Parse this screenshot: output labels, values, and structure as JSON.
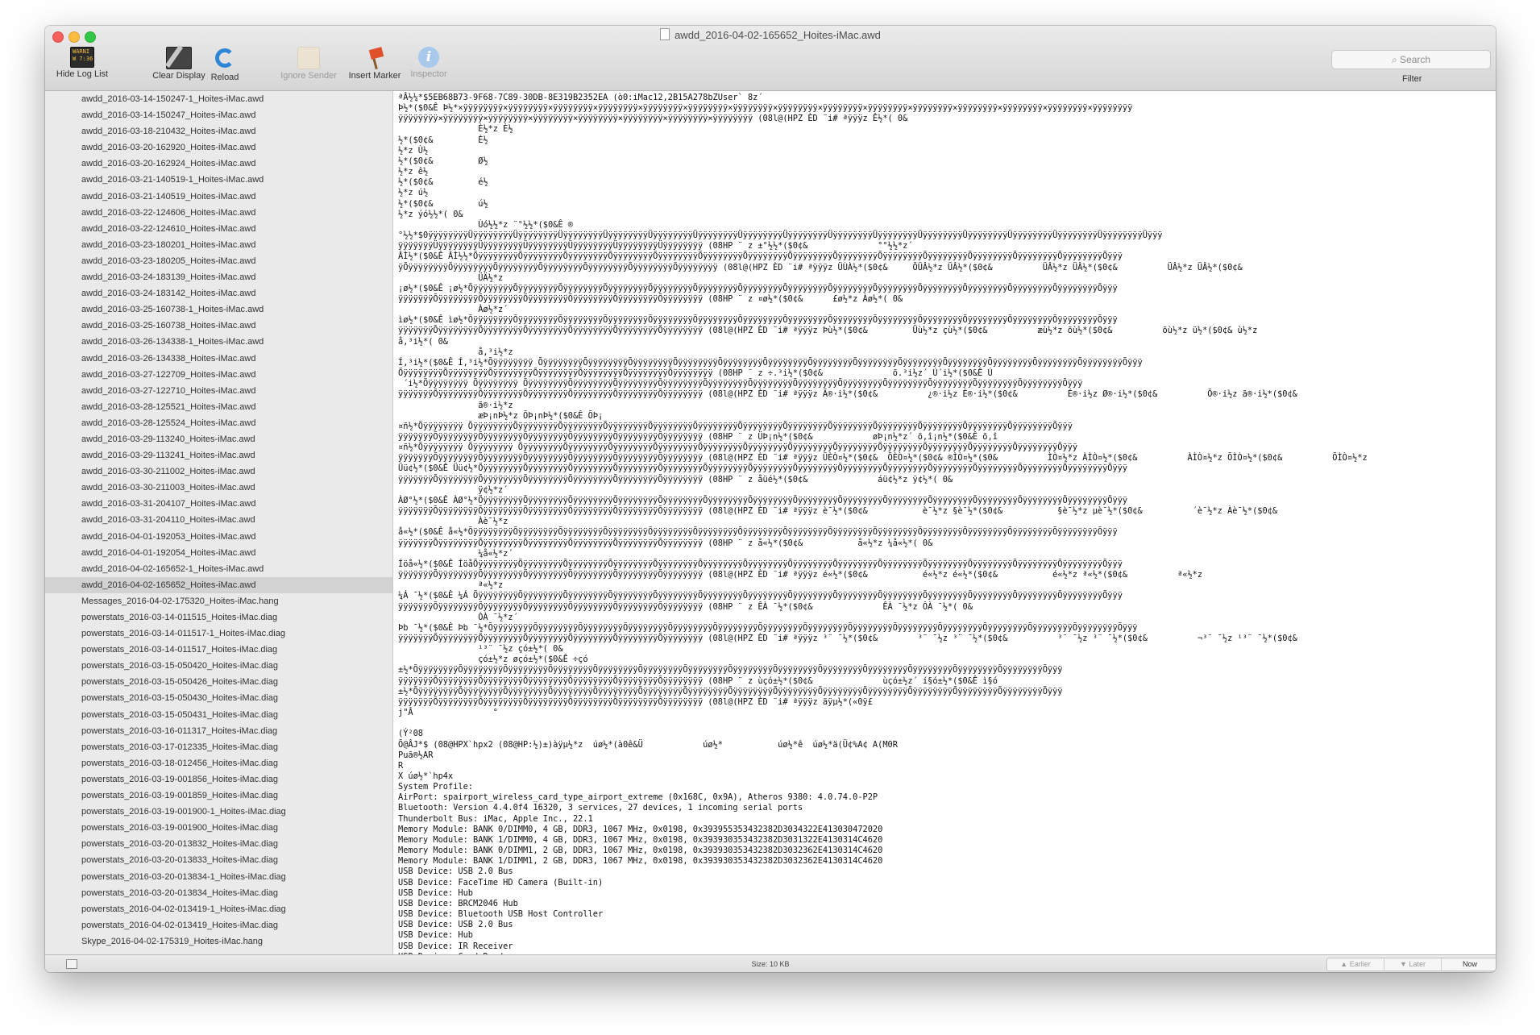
{
  "window": {
    "title": "awdd_2016-04-02-165652_Hoites-iMac.awd"
  },
  "toolbar": {
    "hide_log_list": "Hide Log List",
    "clear_display": "Clear Display",
    "reload": "Reload",
    "ignore_sender": "Ignore Sender",
    "insert_marker": "Insert Marker",
    "inspector": "Inspector",
    "search_placeholder": "Search",
    "filter": "Filter",
    "console_icon_text": "WARNI\nW 7:36"
  },
  "sidebar": {
    "items": [
      "awdd_2016-03-14-150247-1_Hoites-iMac.awd",
      "awdd_2016-03-14-150247_Hoites-iMac.awd",
      "awdd_2016-03-18-210432_Hoites-iMac.awd",
      "awdd_2016-03-20-162920_Hoites-iMac.awd",
      "awdd_2016-03-20-162924_Hoites-iMac.awd",
      "awdd_2016-03-21-140519-1_Hoites-iMac.awd",
      "awdd_2016-03-21-140519_Hoites-iMac.awd",
      "awdd_2016-03-22-124606_Hoites-iMac.awd",
      "awdd_2016-03-22-124610_Hoites-iMac.awd",
      "awdd_2016-03-23-180201_Hoites-iMac.awd",
      "awdd_2016-03-23-180205_Hoites-iMac.awd",
      "awdd_2016-03-24-183139_Hoites-iMac.awd",
      "awdd_2016-03-24-183142_Hoites-iMac.awd",
      "awdd_2016-03-25-160738-1_Hoites-iMac.awd",
      "awdd_2016-03-25-160738_Hoites-iMac.awd",
      "awdd_2016-03-26-134338-1_Hoites-iMac.awd",
      "awdd_2016-03-26-134338_Hoites-iMac.awd",
      "awdd_2016-03-27-122709_Hoites-iMac.awd",
      "awdd_2016-03-27-122710_Hoites-iMac.awd",
      "awdd_2016-03-28-125521_Hoites-iMac.awd",
      "awdd_2016-03-28-125524_Hoites-iMac.awd",
      "awdd_2016-03-29-113240_Hoites-iMac.awd",
      "awdd_2016-03-29-113241_Hoites-iMac.awd",
      "awdd_2016-03-30-211002_Hoites-iMac.awd",
      "awdd_2016-03-30-211003_Hoites-iMac.awd",
      "awdd_2016-03-31-204107_Hoites-iMac.awd",
      "awdd_2016-03-31-204110_Hoites-iMac.awd",
      "awdd_2016-04-01-192053_Hoites-iMac.awd",
      "awdd_2016-04-01-192054_Hoites-iMac.awd",
      "awdd_2016-04-02-165652-1_Hoites-iMac.awd",
      "awdd_2016-04-02-165652_Hoites-iMac.awd",
      "Messages_2016-04-02-175320_Hoites-iMac.hang",
      "powerstats_2016-03-14-011515_Hoites-iMac.diag",
      "powerstats_2016-03-14-011517-1_Hoites-iMac.diag",
      "powerstats_2016-03-14-011517_Hoites-iMac.diag",
      "powerstats_2016-03-15-050420_Hoites-iMac.diag",
      "powerstats_2016-03-15-050426_Hoites-iMac.diag",
      "powerstats_2016-03-15-050430_Hoites-iMac.diag",
      "powerstats_2016-03-15-050431_Hoites-iMac.diag",
      "powerstats_2016-03-16-011317_Hoites-iMac.diag",
      "powerstats_2016-03-17-012335_Hoites-iMac.diag",
      "powerstats_2016-03-18-012456_Hoites-iMac.diag",
      "powerstats_2016-03-19-001856_Hoites-iMac.diag",
      "powerstats_2016-03-19-001859_Hoites-iMac.diag",
      "powerstats_2016-03-19-001900-1_Hoites-iMac.diag",
      "powerstats_2016-03-19-001900_Hoites-iMac.diag",
      "powerstats_2016-03-20-013832_Hoites-iMac.diag",
      "powerstats_2016-03-20-013833_Hoites-iMac.diag",
      "powerstats_2016-03-20-013834-1_Hoites-iMac.diag",
      "powerstats_2016-03-20-013834_Hoites-iMac.diag",
      "powerstats_2016-04-02-013419-1_Hoites-iMac.diag",
      "powerstats_2016-04-02-013419_Hoites-iMac.diag",
      "Skype_2016-04-02-175319_Hoites-iMac.hang"
    ],
    "selected_index": 30
  },
  "log": {
    "text": "ªÂ½¼*$5EB68B73-9F68-7C89-30DB-8E319B2352EA (ò0:iMac12,2B15A278bZUser` 8z´\nÞ½*($0&Ê Þ½*×ÿÿÿÿÿÿÿÿ×ÿÿÿÿÿÿÿÿ×ÿÿÿÿÿÿÿÿ×ÿÿÿÿÿÿÿÿ×ÿÿÿÿÿÿÿÿ×ÿÿÿÿÿÿÿÿ×ÿÿÿÿÿÿÿÿ×ÿÿÿÿÿÿÿÿ×ÿÿÿÿÿÿÿÿ×ÿÿÿÿÿÿÿÿ×ÿÿÿÿÿÿÿÿ×ÿÿÿÿÿÿÿÿ×ÿÿÿÿÿÿÿÿ×ÿÿÿÿÿÿÿÿ×ÿÿÿÿÿÿÿÿ\nÿÿÿÿÿÿÿÿ×ÿÿÿÿÿÿÿÿ×ÿÿÿÿÿÿÿÿ×ÿÿÿÿÿÿÿÿ×ÿÿÿÿÿÿÿÿ×ÿÿÿÿÿÿÿÿ×ÿÿÿÿÿÿÿÿ×ÿÿÿÿÿÿÿÿ (08l@(HPZ ÈD ¨i# ªÿÿÿz Ê½*( 0&\n                È½*z È½\n½*($0¢&         È½\n½*z Ù½\n½*($0¢&         Ø½\n½*z ê½\n½*($0¢&         é½\n½*z ú½\n½*($0¢&         ú½\n½*z ýó½½*( 0&\n                Ùó½½*z ¨°½½*($0&Ê ®\n°½½*$0ÿÿÿÿÿÿÿÿÜÿÿÿÿÿÿÿÿÜÿÿÿÿÿÿÿÿÜÿÿÿÿÿÿÿÿÜÿÿÿÿÿÿÿÿÜÿÿÿÿÿÿÿÿÜÿÿÿÿÿÿÿÿÜÿÿÿÿÿÿÿÿÜÿÿÿÿÿÿÿÿÜÿÿÿÿÿÿÿÿÜÿÿÿÿÿÿÿÿÜÿÿÿÿÿÿÿÿÜÿÿÿÿÿÿÿÿÜÿÿÿÿÿÿÿÿÜÿÿÿÿÿÿÿÿÜÿÿÿÿÿÿÿÿÜÿÿÿ\nÿÿÿÿÿÿÿÜÿÿÿÿÿÿÿÿÜÿÿÿÿÿÿÿÿÜÿÿÿÿÿÿÿÿÜÿÿÿÿÿÿÿÿÜÿÿÿÿÿÿÿÿÜÿÿÿÿÿÿÿÿ (08HP ¨ z ±°½½*($0¢&              °°½½*z´\nÂÌ½*($0&Ê ÂÌ½½*ÕÿÿÿÿÿÿÿÿÕÿÿÿÿÿÿÿÿÕÿÿÿÿÿÿÿÿÕÿÿÿÿÿÿÿÿÕÿÿÿÿÿÿÿÿÕÿÿÿÿÿÿÿÿÕÿÿÿÿÿÿÿÿÕÿÿÿÿÿÿÿÿÕÿÿÿÿÿÿÿÿÕÿÿÿÿÿÿÿÿÕÿÿÿÿÿÿÿÿÕÿÿÿÿÿÿÿÿÕÿÿÿÿÿÿÿÿÕÿÿÿÿÿÿÿÿÕÿÿÿ\nÿÕÿÿÿÿÿÿÿÿÕÿÿÿÿÿÿÿÿÕÿÿÿÿÿÿÿÿÕÿÿÿÿÿÿÿÿÕÿÿÿÿÿÿÿÿÕÿÿÿÿÿÿÿÿÕÿÿÿÿÿÿÿÿ (08l@(HPZ ÈD ¨i# ªÿÿÿz ÜÙÀ½*($0¢&     ÕÜÂ½*z ÜÂ½*($0¢&          ÜÂ½*z ÜÂ½*($0¢&          ÜÂ½*z ÜÂ½*($0¢&\n                ÜÄ½*z\n¡ø½*($0&Ê ¡ø½*ÕÿÿÿÿÿÿÿÿÕÿÿÿÿÿÿÿÿÕÿÿÿÿÿÿÿÿÕÿÿÿÿÿÿÿÿÕÿÿÿÿÿÿÿÿÕÿÿÿÿÿÿÿÿÕÿÿÿÿÿÿÿÿÕÿÿÿÿÿÿÿÿÕÿÿÿÿÿÿÿÿÕÿÿÿÿÿÿÿÿÕÿÿÿÿÿÿÿÿÕÿÿÿÿÿÿÿÿÕÿÿÿÿÿÿÿÿÕÿÿÿÿÿÿÿÿÕÿÿÿ\nÿÿÿÿÿÿÿÕÿÿÿÿÿÿÿÿÕÿÿÿÿÿÿÿÿÕÿÿÿÿÿÿÿÿÕÿÿÿÿÿÿÿÿÕÿÿÿÿÿÿÿÿÕÿÿÿÿÿÿÿÿ (08HP ¨ z ¤ø½*($0¢&      £ø½*z Àø½*( 0&\n                Àø½*z´\nìø½*($0&Ê ìø½*ÕÿÿÿÿÿÿÿÿÕÿÿÿÿÿÿÿÿÕÿÿÿÿÿÿÿÿÕÿÿÿÿÿÿÿÿÕÿÿÿÿÿÿÿÿÕÿÿÿÿÿÿÿÿÕÿÿÿÿÿÿÿÿÕÿÿÿÿÿÿÿÿÕÿÿÿÿÿÿÿÿÕÿÿÿÿÿÿÿÿÕÿÿÿÿÿÿÿÿÕÿÿÿÿÿÿÿÿÕÿÿÿÿÿÿÿÿÕÿÿÿÿÿÿÿÿÕÿÿÿ\nÿÿÿÿÿÿÿÕÿÿÿÿÿÿÿÿÕÿÿÿÿÿÿÿÿÕÿÿÿÿÿÿÿÿÕÿÿÿÿÿÿÿÿÕÿÿÿÿÿÿÿÿÕÿÿÿÿÿÿÿÿ (08l@(HPZ ÈD ¨i# ªÿÿÿz Þù½*($0¢&         Üù½*z çù½*($0¢&          æù½*z õù½*($0¢&          õù½*z ü½*($0¢& ù½*z\nå,³i½*( 0&\n                å,³i½*z\nÍ,³i½*($0&Ê Í,³i½*Õÿÿÿÿÿÿÿÿ ÕÿÿÿÿÿÿÿÿÕÿÿÿÿÿÿÿÿÕÿÿÿÿÿÿÿÿÕÿÿÿÿÿÿÿÿÕÿÿÿÿÿÿÿÿÕÿÿÿÿÿÿÿÿÕÿÿÿÿÿÿÿÿÕÿÿÿÿÿÿÿÿÕÿÿÿÿÿÿÿÿÕÿÿÿÿÿÿÿÿÕÿÿÿÿÿÿÿÿÕÿÿÿÿÿÿÿÿÕÿÿÿÿÿÿÿÿÕÿÿÿ\nÕÿÿÿÿÿÿÿÿÕÿÿÿÿÿÿÿÿÕÿÿÿÿÿÿÿÿÕÿÿÿÿÿÿÿÿÕÿÿÿÿÿÿÿÿÕÿÿÿÿÿÿÿÿÕÿÿÿÿÿÿÿÿ (08HP ¨ z ÷.³i½*($0¢&              õ.³i½z´ Ú´i½*($0&Ê Ú\n ´i½*Õÿÿÿÿÿÿÿÿ Õÿÿÿÿÿÿÿÿ ÕÿÿÿÿÿÿÿÿÕÿÿÿÿÿÿÿÿÕÿÿÿÿÿÿÿÿÕÿÿÿÿÿÿÿÿÕÿÿÿÿÿÿÿÿÕÿÿÿÿÿÿÿÿÕÿÿÿÿÿÿÿÿÕÿÿÿÿÿÿÿÿÕÿÿÿÿÿÿÿÿÕÿÿÿÿÿÿÿÿÕÿÿÿÿÿÿÿÿÕÿÿÿÿÿÿÿÿÕÿÿÿ\nÿÿÿÿÿÿÿÕÿÿÿÿÿÿÿÿÕÿÿÿÿÿÿÿÿÕÿÿÿÿÿÿÿÿÕÿÿÿÿÿÿÿÿÕÿÿÿÿÿÿÿÿÕÿÿÿÿÿÿÿÿ (08l@(HPZ ÈD ¨i# ªÿÿÿz Ã®·i½*($0¢&          ¿®·i½z È®·i½*($0¢&          É®·i½z Ø®·i½*($0¢&          Ö®·i½z ã®·i½*($0¢&\n                ã®·i½*z\n                æÞ¡nÞ½*z ÕÞ¡nÞ½*($0&Ê ÕÞ¡\n¤ñ½*Õÿÿÿÿÿÿÿÿ ÕÿÿÿÿÿÿÿÿÕÿÿÿÿÿÿÿÿÕÿÿÿÿÿÿÿÿÕÿÿÿÿÿÿÿÿÕÿÿÿÿÿÿÿÿÕÿÿÿÿÿÿÿÿÕÿÿÿÿÿÿÿÿÕÿÿÿÿÿÿÿÿÕÿÿÿÿÿÿÿÿÕÿÿÿÿÿÿÿÿÕÿÿÿÿÿÿÿÿÕÿÿÿÿÿÿÿÿÕÿÿÿÿÿÿÿÿÕÿÿÿ\nÿÿÿÿÿÿÿÕÿÿÿÿÿÿÿÿÕÿÿÿÿÿÿÿÿÕÿÿÿÿÿÿÿÿÕÿÿÿÿÿÿÿÿÕÿÿÿÿÿÿÿÿÕÿÿÿÿÿÿÿÿ (08HP ¨ z ÜÞ¡n½*($0¢&            øÞ¡n½*z´ õ,î¡n½*($0&Ê õ,î\n¤ñ½*Õÿÿÿÿÿÿÿÿ Õÿÿÿÿÿÿÿÿ ÕÿÿÿÿÿÿÿÿÕÿÿÿÿÿÿÿÿÕÿÿÿÿÿÿÿÿÕÿÿÿÿÿÿÿÿÕÿÿÿÿÿÿÿÿÕÿÿÿÿÿÿÿÿÕÿÿÿÿÿÿÿÿÕÿÿÿÿÿÿÿÿÕÿÿÿÿÿÿÿÿÕÿÿÿÿÿÿÿÿÕÿÿÿÿÿÿÿÿÕÿÿÿÿÿÿÿÿÕÿÿÿ\nÿÿÿÿÿÿÿÕÿÿÿÿÿÿÿÿÕÿÿÿÿÿÿÿÿÕÿÿÿÿÿÿÿÿÕÿÿÿÿÿÿÿÿÕÿÿÿÿÿÿÿÿÕÿÿÿÿÿÿÿÿ (08l@(HPZ ÈD ¨i# ªÿÿÿz ÜÈÒ¤½*($0¢&  ÕÈÒ¤½*($0¢& ®ÌÒ¤½*($0&          ÌÒ¤½*z ÀÌÒ¤½*($0¢&          ÀÌÒ¤½*z ÕÌÒ¤½*($0¢&          ÕÌÒ¤½*z\nÜü¢½*($0&Ê Üü¢½*ÕÿÿÿÿÿÿÿÿÕÿÿÿÿÿÿÿÿÕÿÿÿÿÿÿÿÿÕÿÿÿÿÿÿÿÿÕÿÿÿÿÿÿÿÿÕÿÿÿÿÿÿÿÿÕÿÿÿÿÿÿÿÿÕÿÿÿÿÿÿÿÿÕÿÿÿÿÿÿÿÿÕÿÿÿÿÿÿÿÿÕÿÿÿÿÿÿÿÿÕÿÿÿÿÿÿÿÿÕÿÿÿÿÿÿÿÿÕÿÿÿÿÿÿÿÿÕÿÿÿ\nÿÿÿÿÿÿÿÕÿÿÿÿÿÿÿÿÕÿÿÿÿÿÿÿÿÕÿÿÿÿÿÿÿÿÕÿÿÿÿÿÿÿÿÕÿÿÿÿÿÿÿÿÕÿÿÿÿÿÿÿÿ (08HP ¨ z åüé½*($0¢&              áü¢½*z ÿ¢½*( 0&\n                ÿ¢½*z´\nÀØ°½*($0&Ê ÀØ°½*ÕÿÿÿÿÿÿÿÿÕÿÿÿÿÿÿÿÿÕÿÿÿÿÿÿÿÿÕÿÿÿÿÿÿÿÿÕÿÿÿÿÿÿÿÿÕÿÿÿÿÿÿÿÿÕÿÿÿÿÿÿÿÿÕÿÿÿÿÿÿÿÿÕÿÿÿÿÿÿÿÿÕÿÿÿÿÿÿÿÿÕÿÿÿÿÿÿÿÿÕÿÿÿÿÿÿÿÿÕÿÿÿÿÿÿÿÿÕÿÿÿÿÿÿÿÿÕÿÿÿ\nÿÿÿÿÿÿÿÕÿÿÿÿÿÿÿÿÕÿÿÿÿÿÿÿÿÕÿÿÿÿÿÿÿÿÕÿÿÿÿÿÿÿÿÕÿÿÿÿÿÿÿÿÕÿÿÿÿÿÿÿÿ (08l@(HPZ ÈD ¨i# ªÿÿÿz è¯½*($0¢&           è¯½*z §è¯½*($0¢&           §è¯½*z µè¯½*($0¢&          ´è¯½*z Àè¯½*($0¢&\n                Àè¯½*z\nå«½*($0&Ê å«½*ÕÿÿÿÿÿÿÿÿÕÿÿÿÿÿÿÿÿÕÿÿÿÿÿÿÿÿÕÿÿÿÿÿÿÿÿÕÿÿÿÿÿÿÿÿÕÿÿÿÿÿÿÿÿÕÿÿÿÿÿÿÿÿÕÿÿÿÿÿÿÿÿÕÿÿÿÿÿÿÿÿÕÿÿÿÿÿÿÿÿÕÿÿÿÿÿÿÿÿÕÿÿÿÿÿÿÿÿÕÿÿÿÿÿÿÿÿÕÿÿÿÿÿÿÿÿÕÿÿÿ\nÿÿÿÿÿÿÿÕÿÿÿÿÿÿÿÿÕÿÿÿÿÿÿÿÿÕÿÿÿÿÿÿÿÿÕÿÿÿÿÿÿÿÿÕÿÿÿÿÿÿÿÿÕÿÿÿÿÿÿÿÿ (08HP ¨ z å«½*($0¢&           å«½*z ¼å«½*( 0&\n                ¼å«½*z´\nÍöå«½*($0&Ê ÍöåÕÿÿÿÿÿÿÿÿÕÿÿÿÿÿÿÿÿÕÿÿÿÿÿÿÿÿÕÿÿÿÿÿÿÿÿÕÿÿÿÿÿÿÿÿÕÿÿÿÿÿÿÿÿÕÿÿÿÿÿÿÿÿÕÿÿÿÿÿÿÿÿÕÿÿÿÿÿÿÿÿÕÿÿÿÿÿÿÿÿÕÿÿÿÿÿÿÿÿÕÿÿÿÿÿÿÿÿÕÿÿÿÿÿÿÿÿÕÿÿÿÿÿÿÿÿÕÿÿÿ\nÿÿÿÿÿÿÿÕÿÿÿÿÿÿÿÿÕÿÿÿÿÿÿÿÿÕÿÿÿÿÿÿÿÿÕÿÿÿÿÿÿÿÿÕÿÿÿÿÿÿÿÿÕÿÿÿÿÿÿÿÿ (08l@(HPZ ÈD ¨i# ªÿÿÿz é«½*($0¢&           é«½*z é«½*($0¢&           é«½*z ª«½*($0¢&          ª«½*z\n                ª«½*z\n¼Á ¯½*($0&Ê ¼Á ÕÿÿÿÿÿÿÿÿÕÿÿÿÿÿÿÿÿÕÿÿÿÿÿÿÿÿÕÿÿÿÿÿÿÿÿÕÿÿÿÿÿÿÿÿÕÿÿÿÿÿÿÿÿÕÿÿÿÿÿÿÿÿÕÿÿÿÿÿÿÿÿÕÿÿÿÿÿÿÿÿÕÿÿÿÿÿÿÿÿÕÿÿÿÿÿÿÿÿÕÿÿÿÿÿÿÿÿÕÿÿÿÿÿÿÿÿÕÿÿÿÿÿÿÿÿÕÿÿÿ\nÿÿÿÿÿÿÿÕÿÿÿÿÿÿÿÿÕÿÿÿÿÿÿÿÿÕÿÿÿÿÿÿÿÿÕÿÿÿÿÿÿÿÿÕÿÿÿÿÿÿÿÿÕÿÿÿÿÿÿÿÿ (08HP ¨ z ÊÀ ¯½*($0¢&              ÊÀ ¯½*z ÔÀ ¯½*( 0&\n                ÒÀ ¯½*z´\nÞb ¯½*($0&Ê Þb ¯½*ÕÿÿÿÿÿÿÿÿÕÿÿÿÿÿÿÿÿÕÿÿÿÿÿÿÿÿÕÿÿÿÿÿÿÿÿÕÿÿÿÿÿÿÿÿÕÿÿÿÿÿÿÿÿÕÿÿÿÿÿÿÿÿÕÿÿÿÿÿÿÿÿÕÿÿÿÿÿÿÿÿÕÿÿÿÿÿÿÿÿÕÿÿÿÿÿÿÿÿÕÿÿÿÿÿÿÿÿÕÿÿÿÿÿÿÿÿÕÿÿÿÿÿÿÿÿÕÿÿÿ\nÿÿÿÿÿÿÿÕÿÿÿÿÿÿÿÿÕÿÿÿÿÿÿÿÿÕÿÿÿÿÿÿÿÿÕÿÿÿÿÿÿÿÿÕÿÿÿÿÿÿÿÿÕÿÿÿÿÿÿÿÿ (08l@(HPZ ÈD ¨i# ªÿÿÿz ³¨ ¯½*($0¢&        ³¨ ¯½z ³¨ ¯½*($0¢&          ³¨ ¯½z ³¨ ¯½*($0¢&          ¬³¨ ¯½z ¹³¨ ¯½*($0¢&\n                ¹³¨ ¯½z çó±½*( 0&\n                çó±½*z øçó±½*($0&Ê ÷çó\n±½*ÕÿÿÿÿÿÿÿÿÕÿÿÿÿÿÿÿÿÕÿÿÿÿÿÿÿÿÕÿÿÿÿÿÿÿÿÕÿÿÿÿÿÿÿÿÕÿÿÿÿÿÿÿÿÕÿÿÿÿÿÿÿÿÕÿÿÿÿÿÿÿÿÕÿÿÿÿÿÿÿÿÕÿÿÿÿÿÿÿÿÕÿÿÿÿÿÿÿÿÕÿÿÿÿÿÿÿÿÕÿÿÿÿÿÿÿÿÕÿÿÿÿÿÿÿÿÕÿÿÿ\nÿÿÿÿÿÿÿÕÿÿÿÿÿÿÿÿÕÿÿÿÿÿÿÿÿÕÿÿÿÿÿÿÿÿÕÿÿÿÿÿÿÿÿÕÿÿÿÿÿÿÿÿÕÿÿÿÿÿÿÿÿ (08HP ¨ z ùçó±½*($0¢&              ùçó±½z´ í§ó±½*($0&Ê ì§ó\n±½*ÕÿÿÿÿÿÿÿÿÕÿÿÿÿÿÿÿÿÕÿÿÿÿÿÿÿÿÕÿÿÿÿÿÿÿÿÕÿÿÿÿÿÿÿÿÕÿÿÿÿÿÿÿÿÕÿÿÿÿÿÿÿÿÕÿÿÿÿÿÿÿÿÕÿÿÿÿÿÿÿÿÕÿÿÿÿÿÿÿÿÕÿÿÿÿÿÿÿÿÕÿÿÿÿÿÿÿÿÕÿÿÿÿÿÿÿÿÕÿÿÿÿÿÿÿÿÕÿÿÿ\nÿÿÿÿÿÿÿÕÿÿÿÿÿÿÿÿÕÿÿÿÿÿÿÿÿÕÿÿÿÿÿÿÿÿÕÿÿÿÿÿÿÿÿÕÿÿÿÿÿÿÿÿÕÿÿÿÿÿÿÿÿ (08l@(HPZ ÈD ¨i# ªÿÿÿz äÿµ½*(«0ÿ£\nj\"Â                °\n\n(Ý²08\nÕ@ÂJ*$ (08@HPX`hpx2 (08@HP:½)±)àÿµ½*z  úø½*(à0ê&Ü            úø½*           úø½*ê  úø½*ä(Ü¢%A¢ A(M0R\nPuã®½AR\nR\nX úø½*`hp4x\nSystem Profile:\nAirPort: spairport_wireless_card_type_airport_extreme (0x168C, 0x9A), Atheros 9380: 4.0.74.0-P2P\nBluetooth: Version 4.4.0f4 16320, 3 services, 27 devices, 1 incoming serial ports\nThunderbolt Bus: iMac, Apple Inc., 22.1\nMemory Module: BANK 0/DIMM0, 4 GB, DDR3, 1067 MHz, 0x0198, 0x393955353432382D3034322E413030472020\nMemory Module: BANK 1/DIMM0, 4 GB, DDR3, 1067 MHz, 0x0198, 0x393930353432382D3031322E4130314C4620\nMemory Module: BANK 0/DIMM1, 2 GB, DDR3, 1067 MHz, 0x0198, 0x393930353432382D3032362E4130314C4620\nMemory Module: BANK 1/DIMM1, 2 GB, DDR3, 1067 MHz, 0x0198, 0x393930353432382D3032362E4130314C4620\nUSB Device: USB 2.0 Bus\nUSB Device: FaceTime HD Camera (Built-in)\nUSB Device: Hub\nUSB Device: BRCM2046 Hub\nUSB Device: Bluetooth USB Host Controller\nUSB Device: USB 2.0 Bus\nUSB Device: Hub\nUSB Device: IR Receiver\nUSB Device: Card Reader"
  },
  "statusbar": {
    "size": "Size: 10 KB",
    "earlier": "▲ Earlier",
    "later": "▼ Later",
    "now": "Now"
  }
}
